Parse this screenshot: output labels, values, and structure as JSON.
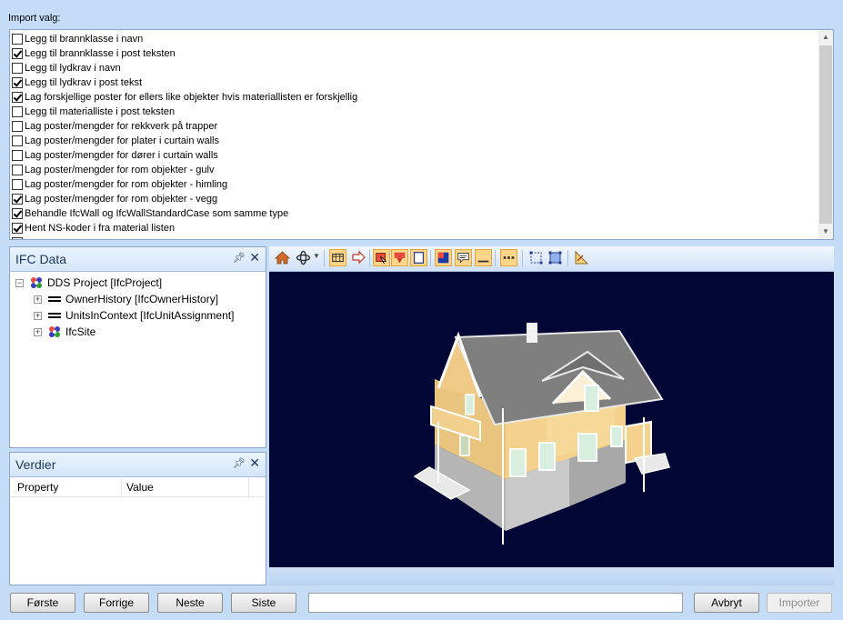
{
  "import_label": "Import valg:",
  "options": [
    {
      "label": "Legg til brannklasse i navn",
      "checked": false
    },
    {
      "label": "Legg til brannklasse i post teksten",
      "checked": true
    },
    {
      "label": "Legg til lydkrav i navn",
      "checked": false
    },
    {
      "label": "Legg til lydkrav i post tekst",
      "checked": true
    },
    {
      "label": "Lag forskjellige poster for ellers like objekter hvis materiallisten er forskjellig",
      "checked": true
    },
    {
      "label": "Legg til materialliste i post teksten",
      "checked": false
    },
    {
      "label": "Lag poster/mengder for rekkverk på trapper",
      "checked": false
    },
    {
      "label": "Lag poster/mengder for plater i curtain walls",
      "checked": false
    },
    {
      "label": "Lag poster/mengder for dører i curtain walls",
      "checked": false
    },
    {
      "label": "Lag poster/mengder for rom objekter - gulv",
      "checked": false
    },
    {
      "label": "Lag poster/mengder for rom objekter - himling",
      "checked": false
    },
    {
      "label": "Lag poster/mengder for rom objekter - vegg",
      "checked": true
    },
    {
      "label": "Behandle IfcWall og IfcWallStandardCase som samme type",
      "checked": true
    },
    {
      "label": "Hent NS-koder i fra material listen",
      "checked": true
    },
    {
      "label": "",
      "checked": false
    }
  ],
  "ifc_panel": {
    "title": "IFC Data",
    "tree": [
      {
        "label": "DDS Project [IfcProject]",
        "expander": "−",
        "icon": "project-icon",
        "level": 0
      },
      {
        "label": "OwnerHistory [IfcOwnerHistory]",
        "expander": "+",
        "icon": "entity-icon",
        "level": 1
      },
      {
        "label": "UnitsInContext [IfcUnitAssignment]",
        "expander": "+",
        "icon": "entity-icon",
        "level": 1
      },
      {
        "label": "IfcSite",
        "expander": "+",
        "icon": "site-icon",
        "level": 1
      }
    ]
  },
  "verdier_panel": {
    "title": "Verdier",
    "columns": [
      "Property",
      "Value"
    ]
  },
  "toolbar_icons": [
    "home-icon",
    "orbit-icon",
    "dropdown-arrow-icon",
    "section-box-icon",
    "walk-icon",
    "select-icon",
    "move-down-icon",
    "frame-icon",
    "render-mode-icon",
    "annotation-icon",
    "line-icon",
    "dots-icon",
    "fit-icon",
    "bounds-icon",
    "measure-icon"
  ],
  "buttons": {
    "first": "Første",
    "previous": "Forrige",
    "next": "Neste",
    "last": "Siste",
    "cancel": "Avbryt",
    "import": "Importer"
  },
  "colors": {
    "background": "#c4dcf6",
    "viewport": "#020634",
    "house_wall": "#f4d28e",
    "house_roof": "#7f7f7f",
    "house_base": "#c0c0c0",
    "active_tool": "#ffd58a"
  }
}
